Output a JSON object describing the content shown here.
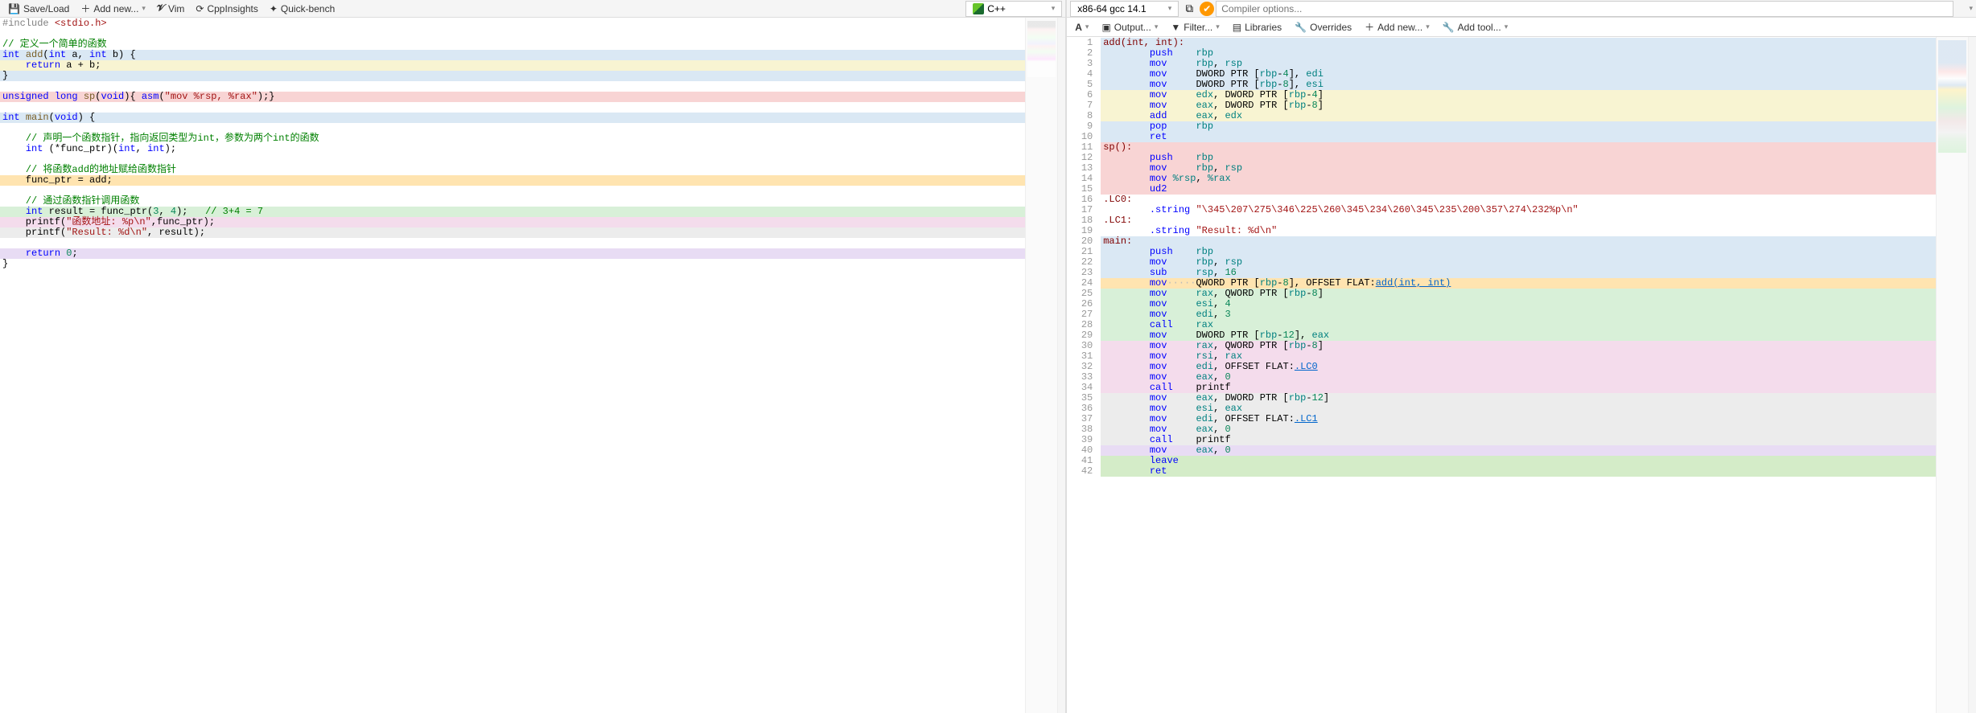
{
  "left_toolbar": {
    "save_load": "Save/Load",
    "add_new": "Add new...",
    "vim": "Vim",
    "cppinsights": "CppInsights",
    "quickbench": "Quick-bench",
    "language": "C++"
  },
  "right_toolbar": {
    "compiler": "x86-64 gcc 14.1",
    "compiler_options_placeholder": "Compiler options..."
  },
  "right_subbar": {
    "a_menu": "A",
    "output": "Output...",
    "filter": "Filter...",
    "libraries": "Libraries",
    "overrides": "Overrides",
    "add_new": "Add new...",
    "add_tool": "Add tool..."
  },
  "source_lines": [
    {
      "bg": "",
      "html": "<span class='tk-pp'>#include</span> <span class='tk-str'>&lt;stdio.h&gt;</span>"
    },
    {
      "bg": "",
      "html": ""
    },
    {
      "bg": "",
      "html": "<span class='tk-cmt'>// 定义一个简单的函数</span>"
    },
    {
      "bg": "bg-blue",
      "html": "<span class='tk-type'>int</span> <span class='tk-fn'>add</span>(<span class='tk-type'>int</span> a, <span class='tk-type'>int</span> b) {"
    },
    {
      "bg": "bg-yellow",
      "html": "    <span class='tk-kw'>return</span> a + b;"
    },
    {
      "bg": "bg-blue",
      "html": "}"
    },
    {
      "bg": "",
      "html": ""
    },
    {
      "bg": "bg-red",
      "html": "<span class='tk-type'>unsigned</span> <span class='tk-type'>long</span> <span class='tk-fn'>sp</span>(<span class='tk-type'>void</span>){ <span class='tk-kw'>asm</span>(<span class='tk-str'>\"mov %rsp, %rax\"</span>);}"
    },
    {
      "bg": "",
      "html": ""
    },
    {
      "bg": "bg-blue",
      "html": "<span class='tk-type'>int</span> <span class='tk-fn'>main</span>(<span class='tk-type'>void</span>) {"
    },
    {
      "bg": "",
      "html": ""
    },
    {
      "bg": "",
      "html": "    <span class='tk-cmt'>// 声明一个函数指针，指向返回类型为int，参数为两个int的函数</span>"
    },
    {
      "bg": "",
      "html": "    <span class='tk-type'>int</span> (*func_ptr)(<span class='tk-type'>int</span>, <span class='tk-type'>int</span>);"
    },
    {
      "bg": "",
      "html": ""
    },
    {
      "bg": "",
      "html": "    <span class='tk-cmt'>// 将函数add的地址赋给函数指针</span>"
    },
    {
      "bg": "bg-orange",
      "html": "    func_ptr = add;"
    },
    {
      "bg": "",
      "html": ""
    },
    {
      "bg": "",
      "html": "    <span class='tk-cmt'>// 通过函数指针调用函数</span>"
    },
    {
      "bg": "bg-green",
      "html": "    <span class='tk-type'>int</span> result = func_ptr(<span class='tk-num'>3</span>, <span class='tk-num'>4</span>);   <span class='tk-cmt'>// 3+4 = 7</span>"
    },
    {
      "bg": "bg-pink",
      "html": "    printf(<span class='tk-str'>\"函数地址: %p\\n\"</span>,func_ptr);"
    },
    {
      "bg": "bg-gray",
      "html": "    printf(<span class='tk-str'>\"Result: %d\\n\"</span>, result);"
    },
    {
      "bg": "",
      "html": ""
    },
    {
      "bg": "bg-purple",
      "html": "    <span class='tk-kw'>return</span> <span class='tk-num'>0</span>;"
    },
    {
      "bg": "",
      "html": "}"
    }
  ],
  "asm_lines": [
    {
      "n": 1,
      "bg": "bg-blue",
      "html": "<span class='tk-asm-lbl'>add(int, int):</span>"
    },
    {
      "n": 2,
      "bg": "bg-blue",
      "html": "        <span class='tk-asm-op'>push</span>    <span class='tk-asm-reg'>rbp</span>"
    },
    {
      "n": 3,
      "bg": "bg-blue",
      "html": "        <span class='tk-asm-op'>mov</span>     <span class='tk-asm-reg'>rbp</span>, <span class='tk-asm-reg'>rsp</span>"
    },
    {
      "n": 4,
      "bg": "bg-blue",
      "html": "        <span class='tk-asm-op'>mov</span>     DWORD PTR [<span class='tk-asm-reg'>rbp</span>-<span class='tk-num'>4</span>], <span class='tk-asm-reg'>edi</span>"
    },
    {
      "n": 5,
      "bg": "bg-blue",
      "html": "        <span class='tk-asm-op'>mov</span>     DWORD PTR [<span class='tk-asm-reg'>rbp</span>-<span class='tk-num'>8</span>], <span class='tk-asm-reg'>esi</span>"
    },
    {
      "n": 6,
      "bg": "bg-yellow",
      "html": "        <span class='tk-asm-op'>mov</span>     <span class='tk-asm-reg'>edx</span>, DWORD PTR [<span class='tk-asm-reg'>rbp</span>-<span class='tk-num'>4</span>]"
    },
    {
      "n": 7,
      "bg": "bg-yellow",
      "html": "        <span class='tk-asm-op'>mov</span>     <span class='tk-asm-reg'>eax</span>, DWORD PTR [<span class='tk-asm-reg'>rbp</span>-<span class='tk-num'>8</span>]"
    },
    {
      "n": 8,
      "bg": "bg-yellow",
      "html": "        <span class='tk-asm-op'>add</span>     <span class='tk-asm-reg'>eax</span>, <span class='tk-asm-reg'>edx</span>"
    },
    {
      "n": 9,
      "bg": "bg-blue",
      "html": "        <span class='tk-asm-op'>pop</span>     <span class='tk-asm-reg'>rbp</span>"
    },
    {
      "n": 10,
      "bg": "bg-blue",
      "html": "        <span class='tk-asm-op'>ret</span>"
    },
    {
      "n": 11,
      "bg": "bg-red",
      "html": "<span class='tk-asm-lbl'>sp():</span>"
    },
    {
      "n": 12,
      "bg": "bg-red",
      "html": "        <span class='tk-asm-op'>push</span>    <span class='tk-asm-reg'>rbp</span>"
    },
    {
      "n": 13,
      "bg": "bg-red",
      "html": "        <span class='tk-asm-op'>mov</span>     <span class='tk-asm-reg'>rbp</span>, <span class='tk-asm-reg'>rsp</span>"
    },
    {
      "n": 14,
      "bg": "bg-red",
      "html": "        <span class='tk-asm-op'>mov</span> <span class='tk-asm-reg'>%rsp</span>, <span class='tk-asm-reg'>%rax</span>"
    },
    {
      "n": 15,
      "bg": "bg-red",
      "html": "        <span class='tk-asm-op'>ud2</span>"
    },
    {
      "n": 16,
      "bg": "",
      "html": "<span class='tk-asm-lbl'>.LC0:</span>"
    },
    {
      "n": 17,
      "bg": "",
      "html": "        <span class='tk-asm-op'>.string</span> <span class='tk-str'>\"\\345\\207\\275\\346\\225\\260\\345\\234\\260\\345\\235\\200\\357\\274\\232%p\\n\"</span>"
    },
    {
      "n": 18,
      "bg": "",
      "html": "<span class='tk-asm-lbl'>.LC1:</span>"
    },
    {
      "n": 19,
      "bg": "",
      "html": "        <span class='tk-asm-op'>.string</span> <span class='tk-str'>\"Result: %d\\n\"</span>"
    },
    {
      "n": 20,
      "bg": "bg-blue",
      "html": "<span class='tk-asm-lbl'>main:</span>"
    },
    {
      "n": 21,
      "bg": "bg-blue",
      "html": "        <span class='tk-asm-op'>push</span>    <span class='tk-asm-reg'>rbp</span>"
    },
    {
      "n": 22,
      "bg": "bg-blue",
      "html": "        <span class='tk-asm-op'>mov</span>     <span class='tk-asm-reg'>rbp</span>, <span class='tk-asm-reg'>rsp</span>"
    },
    {
      "n": 23,
      "bg": "bg-blue",
      "html": "        <span class='tk-asm-op'>sub</span>     <span class='tk-asm-reg'>rsp</span>, <span class='tk-num'>16</span>"
    },
    {
      "n": 24,
      "bg": "bg-orange",
      "html": "        <span class='tk-asm-op'>mov</span><span class='faded'>·····</span>QWORD PTR [<span class='tk-asm-reg'>rbp</span>-<span class='tk-num'>8</span>], OFFSET FLAT:<span class='tk-link'>add(int,&nbsp;int)</span>"
    },
    {
      "n": 25,
      "bg": "bg-green",
      "html": "        <span class='tk-asm-op'>mov</span>     <span class='tk-asm-reg'>rax</span>, QWORD PTR [<span class='tk-asm-reg'>rbp</span>-<span class='tk-num'>8</span>]"
    },
    {
      "n": 26,
      "bg": "bg-green",
      "html": "        <span class='tk-asm-op'>mov</span>     <span class='tk-asm-reg'>esi</span>, <span class='tk-num'>4</span>"
    },
    {
      "n": 27,
      "bg": "bg-green",
      "html": "        <span class='tk-asm-op'>mov</span>     <span class='tk-asm-reg'>edi</span>, <span class='tk-num'>3</span>"
    },
    {
      "n": 28,
      "bg": "bg-green",
      "html": "        <span class='tk-asm-op'>call</span>    <span class='tk-asm-reg'>rax</span>"
    },
    {
      "n": 29,
      "bg": "bg-green",
      "html": "        <span class='tk-asm-op'>mov</span>     DWORD PTR [<span class='tk-asm-reg'>rbp</span>-<span class='tk-num'>12</span>], <span class='tk-asm-reg'>eax</span>"
    },
    {
      "n": 30,
      "bg": "bg-pink",
      "html": "        <span class='tk-asm-op'>mov</span>     <span class='tk-asm-reg'>rax</span>, QWORD PTR [<span class='tk-asm-reg'>rbp</span>-<span class='tk-num'>8</span>]"
    },
    {
      "n": 31,
      "bg": "bg-pink",
      "html": "        <span class='tk-asm-op'>mov</span>     <span class='tk-asm-reg'>rsi</span>, <span class='tk-asm-reg'>rax</span>"
    },
    {
      "n": 32,
      "bg": "bg-pink",
      "html": "        <span class='tk-asm-op'>mov</span>     <span class='tk-asm-reg'>edi</span>, OFFSET FLAT:<span class='tk-link'>.LC0</span>"
    },
    {
      "n": 33,
      "bg": "bg-pink",
      "html": "        <span class='tk-asm-op'>mov</span>     <span class='tk-asm-reg'>eax</span>, <span class='tk-num'>0</span>"
    },
    {
      "n": 34,
      "bg": "bg-pink",
      "html": "        <span class='tk-asm-op'>call</span>    printf"
    },
    {
      "n": 35,
      "bg": "bg-gray",
      "html": "        <span class='tk-asm-op'>mov</span>     <span class='tk-asm-reg'>eax</span>, DWORD PTR [<span class='tk-asm-reg'>rbp</span>-<span class='tk-num'>12</span>]"
    },
    {
      "n": 36,
      "bg": "bg-gray",
      "html": "        <span class='tk-asm-op'>mov</span>     <span class='tk-asm-reg'>esi</span>, <span class='tk-asm-reg'>eax</span>"
    },
    {
      "n": 37,
      "bg": "bg-gray",
      "html": "        <span class='tk-asm-op'>mov</span>     <span class='tk-asm-reg'>edi</span>, OFFSET FLAT:<span class='tk-link'>.LC1</span>"
    },
    {
      "n": 38,
      "bg": "bg-gray",
      "html": "        <span class='tk-asm-op'>mov</span>     <span class='tk-asm-reg'>eax</span>, <span class='tk-num'>0</span>"
    },
    {
      "n": 39,
      "bg": "bg-gray",
      "html": "        <span class='tk-asm-op'>call</span>    printf"
    },
    {
      "n": 40,
      "bg": "bg-purple",
      "html": "        <span class='tk-asm-op'>mov</span>     <span class='tk-asm-reg'>eax</span>, <span class='tk-num'>0</span>"
    },
    {
      "n": 41,
      "bg": "bg-green2",
      "html": "        <span class='tk-asm-op'>leave</span>"
    },
    {
      "n": 42,
      "bg": "bg-green2",
      "html": "        <span class='tk-asm-op'>ret</span>"
    }
  ]
}
